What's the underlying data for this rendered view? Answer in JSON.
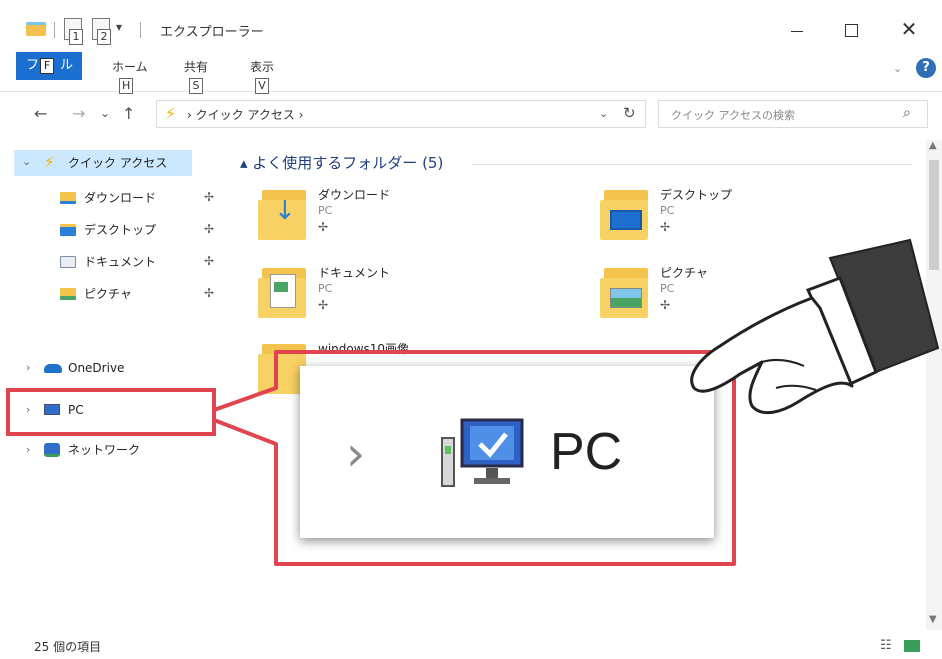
{
  "window": {
    "title": "エクスプローラー",
    "qa_dropdown": "▾",
    "key_tips": {
      "qa1": "1",
      "qa2": "2"
    },
    "close_glyph": "✕"
  },
  "ribbon": {
    "file_tab": "ファイル",
    "file_tab_visible": "フ",
    "file_tab_suffix": "ル",
    "file_key": "F",
    "tabs": [
      {
        "label": "ホーム",
        "key": "H"
      },
      {
        "label": "共有",
        "key": "S"
      },
      {
        "label": "表示",
        "key": "V"
      }
    ],
    "collapse_glyph": "⌄",
    "help_glyph": "?"
  },
  "navigation": {
    "back": "←",
    "forward": "→",
    "recent": "⌄",
    "up": "↑",
    "address_path": "› クイック アクセス ›",
    "address_dropdown": "⌄",
    "refresh": "↻",
    "search_placeholder": "クイック アクセスの検索",
    "search_glyph": "⌕"
  },
  "nav_pane": {
    "quick_access": "クイック アクセス",
    "pinned": [
      {
        "label": "ダウンロード",
        "color": "#2c7fd6"
      },
      {
        "label": "デスクトップ",
        "color": "#2c7fd6"
      },
      {
        "label": "ドキュメント",
        "color": "#7a8fa8"
      },
      {
        "label": "ピクチャ",
        "color": "#4aa564"
      }
    ],
    "onedrive": "OneDrive",
    "pc": "PC",
    "network": "ネットワーク",
    "pin_glyph": "✢",
    "chevron_closed": "›",
    "chevron_open": "⌄"
  },
  "main": {
    "group_header": "▴ よく使用するフォルダー (5)",
    "folders": [
      {
        "name": "ダウンロード",
        "location": "PC"
      },
      {
        "name": "デスクトップ",
        "location": "PC"
      },
      {
        "name": "ドキュメント",
        "location": "PC"
      },
      {
        "name": "ピクチャ",
        "location": "PC"
      },
      {
        "name": "windows10画像",
        "location": ""
      }
    ],
    "pin_glyph": "✢"
  },
  "status": {
    "item_count": "25 個の項目"
  },
  "callout": {
    "chevron": "›",
    "label": "PC",
    "highlight_color": "#e0454f"
  },
  "colors": {
    "accent": "#1a6fd0",
    "selection": "#cce8ff",
    "folder": "#f3c34d"
  }
}
